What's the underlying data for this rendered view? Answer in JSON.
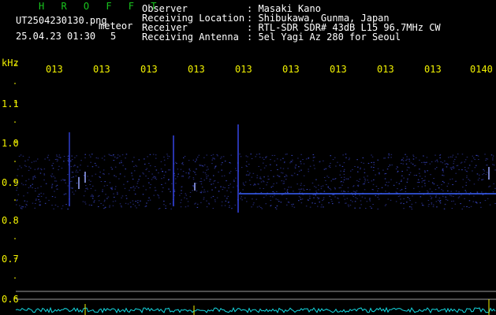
{
  "header": {
    "app_title": "H R O F F T",
    "filename": "UT2504230130.png",
    "datetime": "25.04.23 01:30",
    "mode_label": "meteor",
    "count": "5",
    "observer_label": "Observer",
    "observer_value": ": Masaki Kano",
    "location_label": "Receiving Location",
    "location_value": ": Shibukawa, Gunma, Japan",
    "receiver_label": "Receiver",
    "receiver_value": ": RTL-SDR SDR# 43dB L15 96.7MHz CW",
    "antenna_label": "Receiving Antenna",
    "antenna_value": ": 5el Yagi Az 280 for Seoul"
  },
  "time_axis": {
    "ticks": [
      "013",
      "013",
      "013",
      "013",
      "013",
      "013",
      "013",
      "013",
      "013",
      "0140"
    ]
  },
  "freq_axis": {
    "unit": "kHz",
    "ticks": [
      "1.1",
      "1.0",
      "0.9",
      "0.8",
      "0.7",
      "0.6"
    ]
  },
  "colors": {
    "background": "#000000",
    "header_text": "#ffffff",
    "title_green": "#19c61e",
    "axis_text": "#f2f200",
    "spectrum_band": "#2a2f8e",
    "carrier_line": "#3a63ff",
    "baseline_trace": "#14d8e0",
    "marker_yellow": "#f2f200"
  }
}
